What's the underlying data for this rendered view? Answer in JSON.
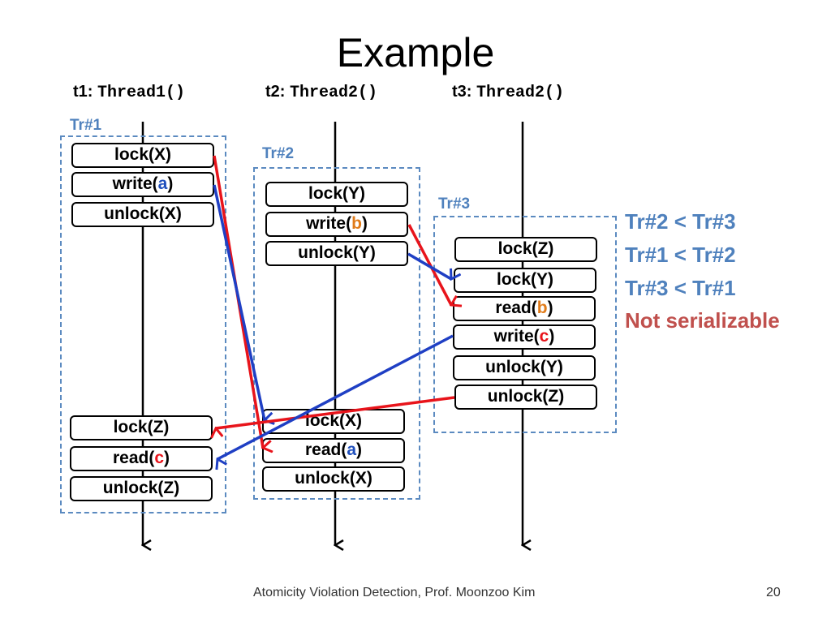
{
  "title": "Example",
  "threads": [
    {
      "id": "t1:",
      "fn": "Thread1()"
    },
    {
      "id": "t2:",
      "fn": "Thread2()"
    },
    {
      "id": "t3:",
      "fn": "Thread2()"
    }
  ],
  "transactions": [
    {
      "label": "Tr#1",
      "ops_top": [
        {
          "pre": "lock(",
          "var": "X",
          "post": ")"
        },
        {
          "pre": "write(",
          "var": "a",
          "post": ")"
        },
        {
          "pre": "unlock(",
          "var": "X",
          "post": ")"
        }
      ],
      "ops_bottom": [
        {
          "pre": "lock(",
          "var": "Z",
          "post": ")"
        },
        {
          "pre": "read(",
          "var": "c",
          "post": ")"
        },
        {
          "pre": "unlock(",
          "var": "Z",
          "post": ")"
        }
      ]
    },
    {
      "label": "Tr#2",
      "ops_top": [
        {
          "pre": "lock(",
          "var": "Y",
          "post": ")"
        },
        {
          "pre": "write(",
          "var": "b",
          "post": ")"
        },
        {
          "pre": "unlock(",
          "var": "Y",
          "post": ")"
        }
      ],
      "ops_bottom": [
        {
          "pre": "lock(",
          "var": "X",
          "post": ")"
        },
        {
          "pre": "read(",
          "var": "a",
          "post": ")"
        },
        {
          "pre": "unlock(",
          "var": "X",
          "post": ")"
        }
      ]
    },
    {
      "label": "Tr#3",
      "ops": [
        {
          "pre": "lock(",
          "var": "Z",
          "post": ")"
        },
        {
          "pre": "lock(",
          "var": "Y",
          "post": ")"
        },
        {
          "pre": "read(",
          "var": "b",
          "post": ")"
        },
        {
          "pre": "write(",
          "var": "c",
          "post": ")"
        },
        {
          "pre": "unlock(",
          "var": "Y",
          "post": ")"
        },
        {
          "pre": "unlock(",
          "var": "Z",
          "post": ")"
        }
      ]
    }
  ],
  "orderings": [
    "Tr#2 ⋖ Tr#3",
    "Tr#1 ⋖ Tr#2",
    "Tr#3 ⋖ Tr#1"
  ],
  "orderings_display": [
    "Tr#2 < Tr#3",
    "Tr#1 < Tr#2",
    "Tr#3 < Tr#1"
  ],
  "verdict": "Not serializable",
  "footer": "Atomicity Violation Detection, Prof. Moonzoo Kim",
  "page_number": "20",
  "colors": {
    "lock_edge": "#e8141b",
    "data_edge": "#1f3fc4",
    "tr_label": "#4f81bd",
    "verdict": "#c0504d"
  }
}
